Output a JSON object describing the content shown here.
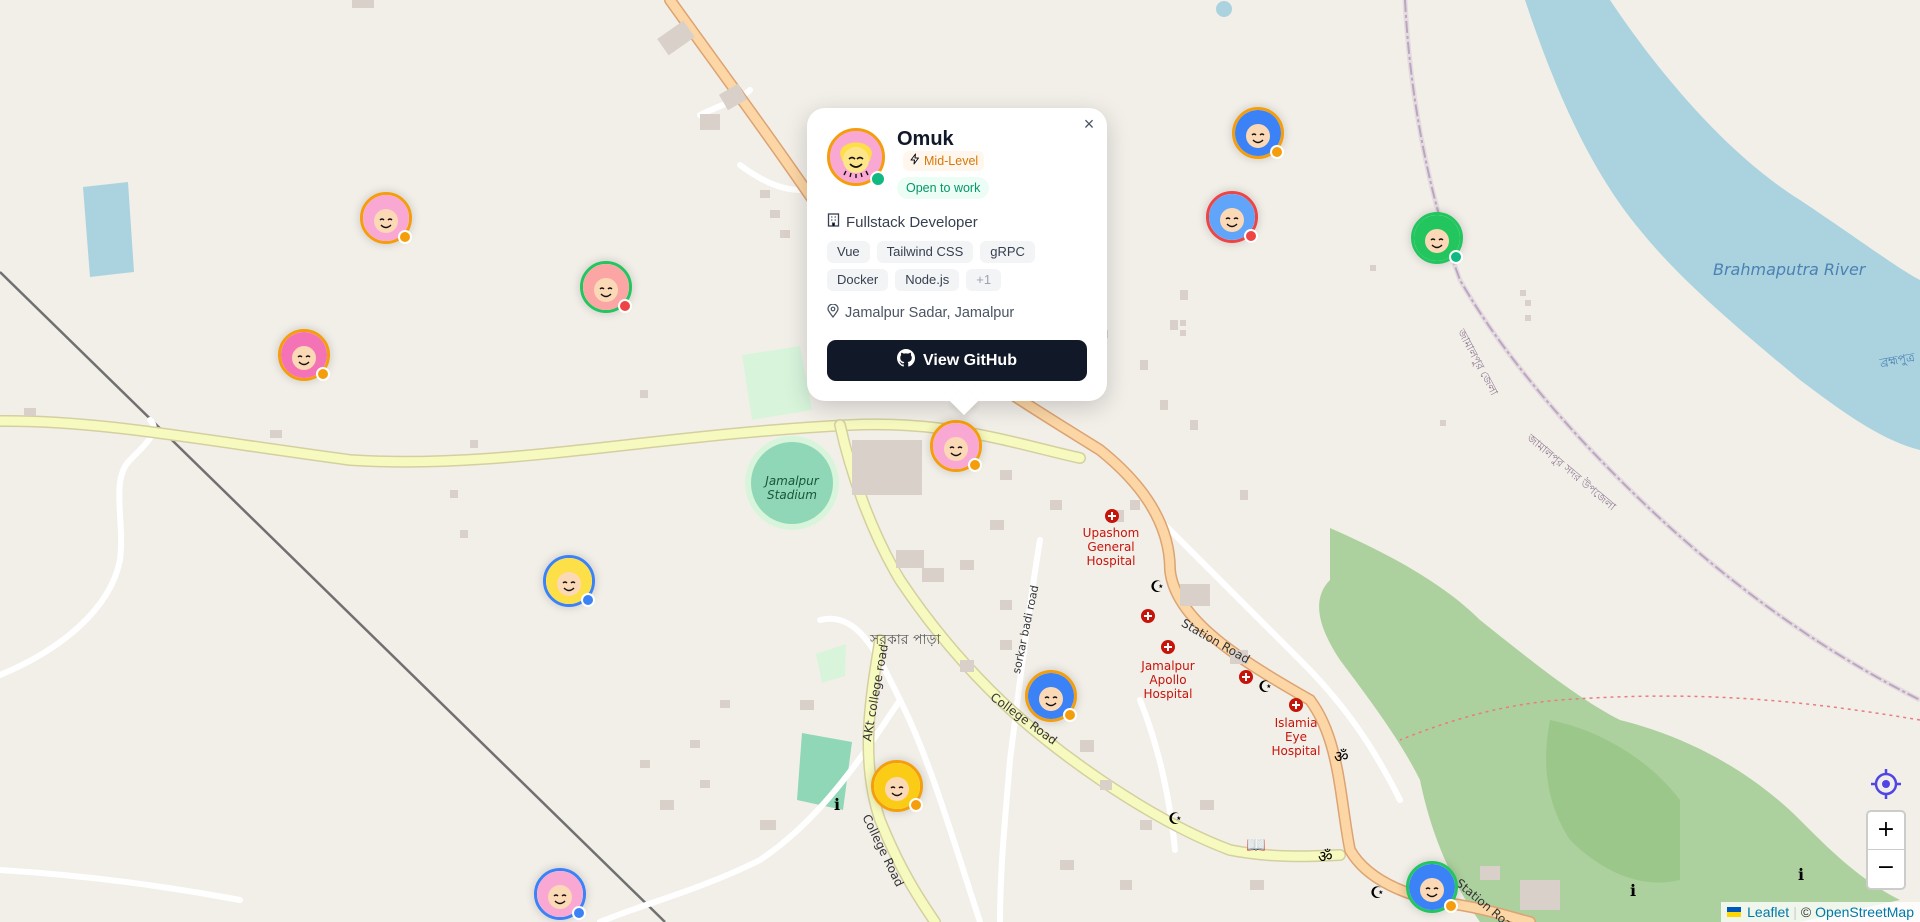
{
  "map": {
    "labels": {
      "brahmaputra": "Brahmaputra River",
      "stadium": "Jamalpur Stadium",
      "sarkar_para": "সরকার পাড়া",
      "college_road_1": "College Road",
      "college_road_2": "College Road",
      "akt_college_road": "AKt college road",
      "sorkar_badi_road": "sorkar badi road",
      "station_road_1": "Station Road",
      "station_road_2": "Station Road",
      "upashom": "Upashom General Hospital",
      "apollo": "Jamalpur Apollo Hospital",
      "islamia": "Islamia Eye Hospital",
      "bengali_district": "জামালপুর জেলা",
      "bengali_upazila": "জামালপুর সদর উপজেলা",
      "bengali_river": "ব্রহ্মপুত্র"
    },
    "developers": [
      {
        "id": "marker-1",
        "ring_color": "#f59e0b",
        "status_color": "#f59e0b",
        "face_color": "#f9a8d4"
      },
      {
        "id": "marker-2",
        "ring_color": "#22c55e",
        "status_color": "#ef4444",
        "face_color": "#fca5a5"
      },
      {
        "id": "marker-3",
        "ring_color": "#f59e0b",
        "status_color": "#f59e0b",
        "face_color": "#f472b6"
      },
      {
        "id": "marker-4",
        "ring_color": "#3b82f6",
        "status_color": "#3b82f6",
        "face_color": "#fde047"
      },
      {
        "id": "marker-omuk",
        "ring_color": "#f59e0b",
        "status_color": "#f59e0b",
        "face_color": "#f9a8d4"
      },
      {
        "id": "marker-6",
        "ring_color": "#f59e0b",
        "status_color": "#f59e0b",
        "face_color": "#3b82f6"
      },
      {
        "id": "marker-7",
        "ring_color": "#ef4444",
        "status_color": "#ef4444",
        "face_color": "#60a5fa"
      },
      {
        "id": "marker-8",
        "ring_color": "#22c55e",
        "status_color": "#10b981",
        "face_color": "#22c55e"
      },
      {
        "id": "marker-9",
        "ring_color": "#f59e0b",
        "status_color": "#f59e0b",
        "face_color": "#3b82f6"
      },
      {
        "id": "marker-10",
        "ring_color": "#f59e0b",
        "status_color": "#f59e0b",
        "face_color": "#facc15"
      },
      {
        "id": "marker-11",
        "ring_color": "#3b82f6",
        "status_color": "#3b82f6",
        "face_color": "#f9a8d4"
      },
      {
        "id": "marker-12",
        "ring_color": "#22c55e",
        "status_color": "#f59e0b",
        "face_color": "#3b82f6"
      }
    ]
  },
  "popup": {
    "close_symbol": "×",
    "name": "Omuk",
    "level": "Mid-Level",
    "level_icon": "lightning-icon",
    "status": "Open to work",
    "role": "Fullstack Developer",
    "role_icon": "building-icon",
    "skills": [
      "Vue",
      "Tailwind CSS",
      "gRPC",
      "Docker",
      "Node.js"
    ],
    "more_skills": "+1",
    "location": "Jamalpur Sadar, Jamalpur",
    "location_icon": "map-pin-icon",
    "button_label": "View GitHub",
    "button_icon": "github-icon",
    "colors": {
      "level": "#d97706",
      "open_to_work": "#059669",
      "button_bg": "#111827"
    }
  },
  "controls": {
    "locate_icon": "crosshair-icon",
    "zoom_in": "+",
    "zoom_out": "−"
  },
  "attribution": {
    "leaflet": "Leaflet",
    "separator": "|",
    "copyright": "©",
    "osm": "OpenStreetMap"
  }
}
